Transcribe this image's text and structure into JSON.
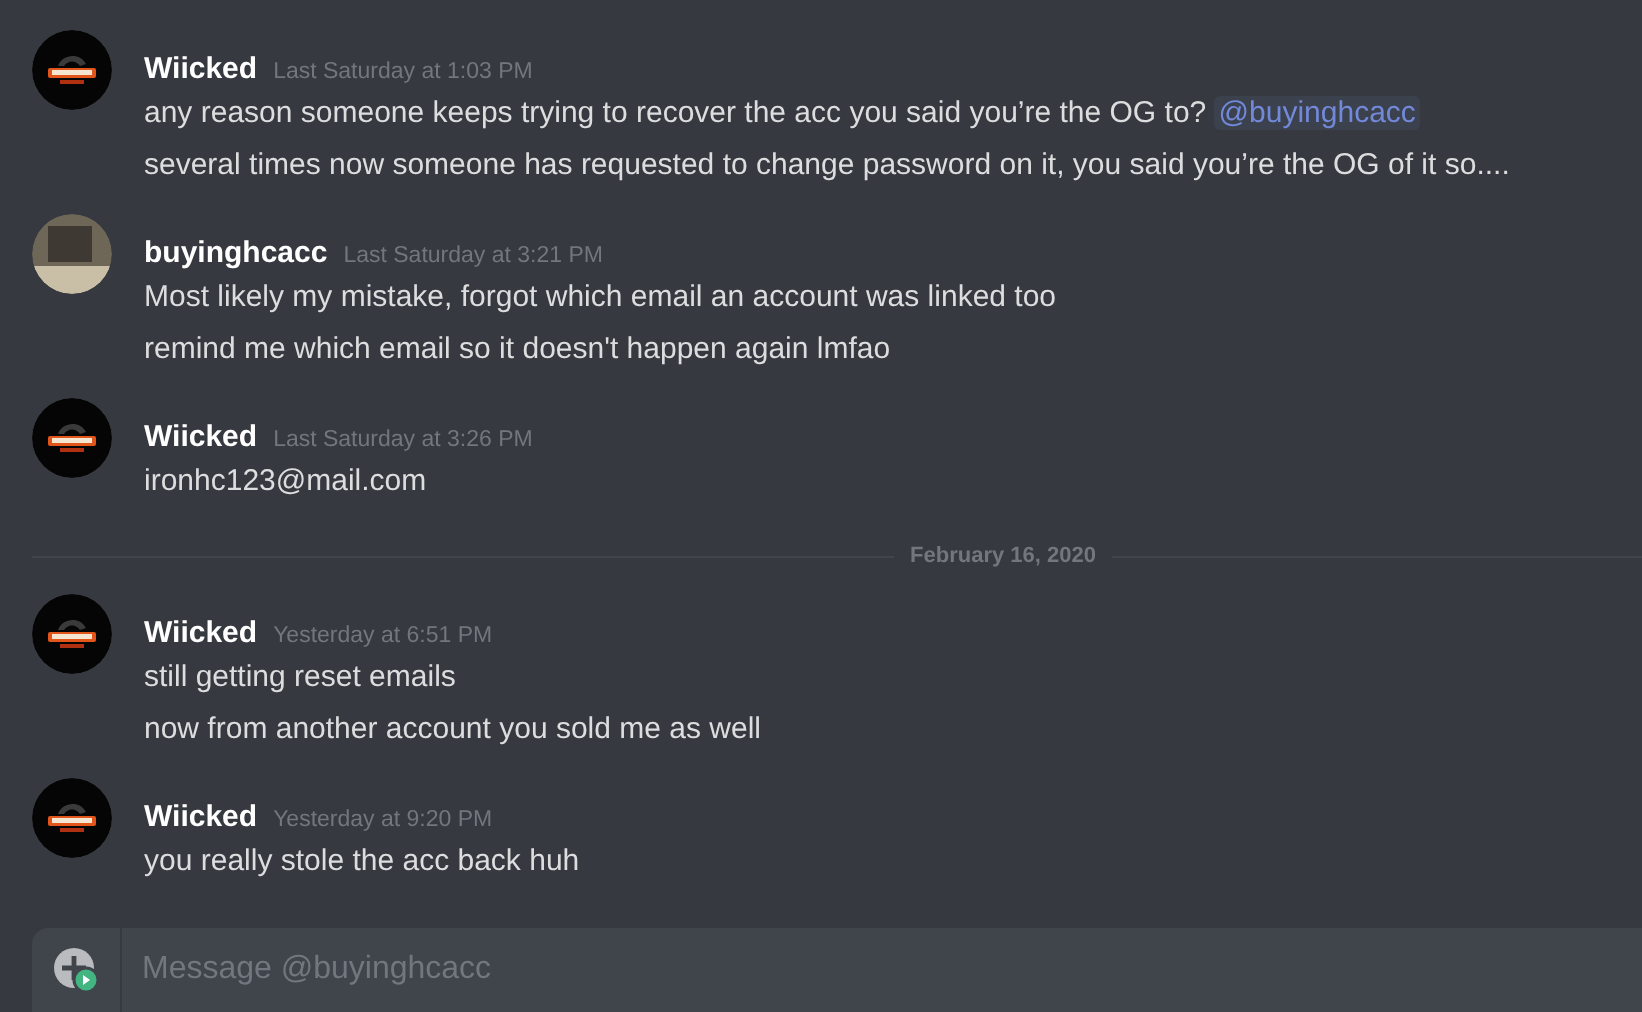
{
  "feed": [
    {
      "kind": "group",
      "author": "Wiicked",
      "avatar": {
        "kind": "logo"
      },
      "timestamp": "Last Saturday at 1:03 PM",
      "lines": [
        {
          "text": "any reason someone keeps trying to recover the acc you said you’re the OG to? ",
          "mention": "@buyinghcacc"
        },
        {
          "text": "several times now someone has requested to change password on it, you said you’re the OG of it so...."
        }
      ]
    },
    {
      "kind": "group",
      "author": "buyinghcacc",
      "avatar": {
        "kind": "photo"
      },
      "timestamp": "Last Saturday at 3:21 PM",
      "lines": [
        {
          "text": "Most likely my mistake, forgot which email an account was linked too"
        },
        {
          "text": "remind me which email so it doesn't happen again lmfao"
        }
      ]
    },
    {
      "kind": "group",
      "author": "Wiicked",
      "avatar": {
        "kind": "logo"
      },
      "timestamp": "Last Saturday at 3:26 PM",
      "lines": [
        {
          "text": "ironhc123@mail.com"
        }
      ]
    },
    {
      "kind": "divider",
      "label": "February 16, 2020"
    },
    {
      "kind": "group",
      "author": "Wiicked",
      "avatar": {
        "kind": "logo"
      },
      "timestamp": "Yesterday at 6:51 PM",
      "lines": [
        {
          "text": "still getting reset emails"
        },
        {
          "text": "now from another account you sold me as well"
        }
      ]
    },
    {
      "kind": "group",
      "author": "Wiicked",
      "avatar": {
        "kind": "logo"
      },
      "timestamp": "Yesterday at 9:20 PM",
      "lines": [
        {
          "text": "you really stole the acc back huh"
        }
      ]
    }
  ],
  "composer": {
    "placeholder": "Message @buyinghcacc"
  }
}
